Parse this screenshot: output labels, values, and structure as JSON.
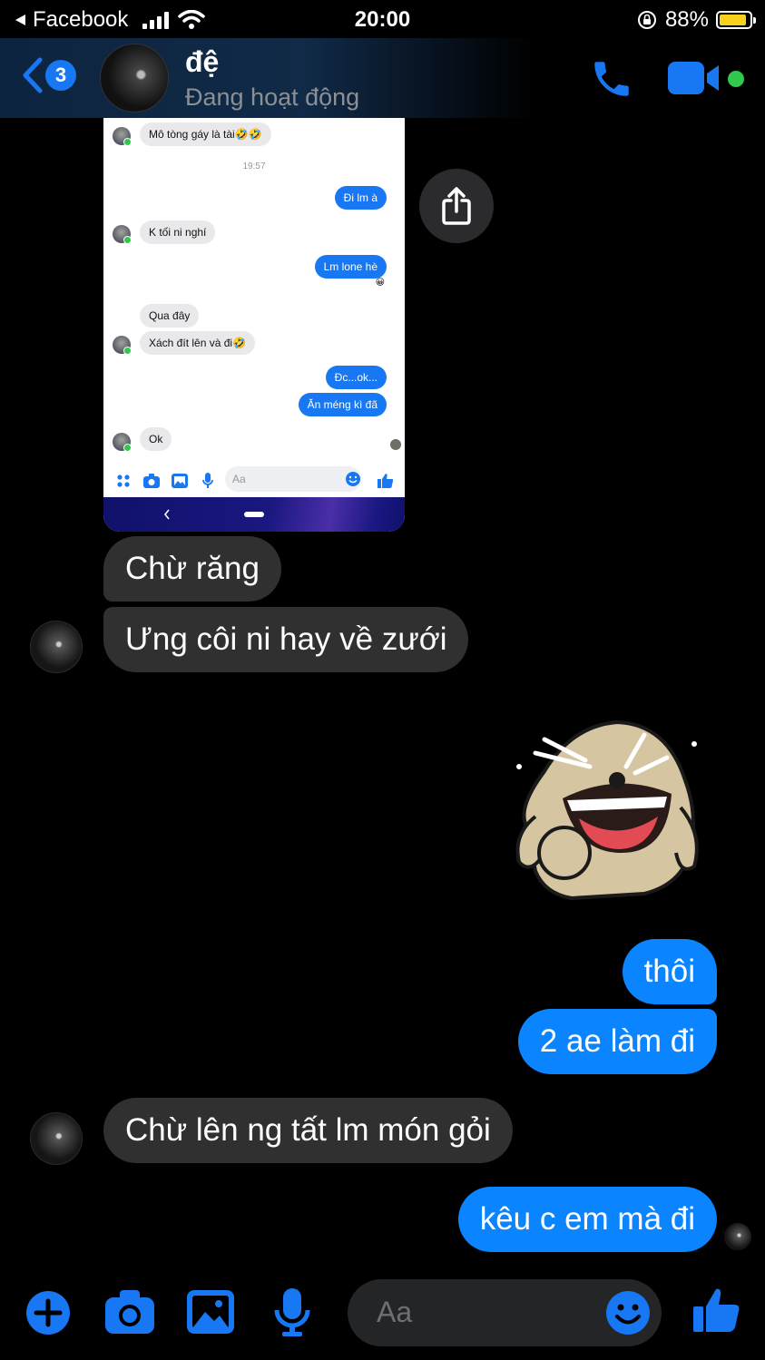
{
  "status_bar": {
    "back_app": "Facebook",
    "time": "20:00",
    "battery": "88%",
    "battery_level": 0.88
  },
  "header": {
    "unread_count": "3",
    "contact_name": "đệ",
    "contact_status": "Đang hoạt động",
    "icons": [
      "back-chevron-icon",
      "phone-icon",
      "video-camera-icon"
    ],
    "accent": "#1877f2",
    "online_color": "#31c84b"
  },
  "shared_screenshot": {
    "messages": [
      {
        "side": "in",
        "text": "Mô tòng gáy là tài🤣🤣"
      },
      {
        "side": "in",
        "text": "K tối ni nghí"
      },
      {
        "side": "out",
        "text": "Đi lm à"
      },
      {
        "side": "out",
        "text": "Lm lone hè"
      },
      {
        "side": "in",
        "text": "Qua đây"
      },
      {
        "side": "in",
        "text": "Xách đít lên và đi🤣"
      },
      {
        "side": "out",
        "text": "Đc...ok..."
      },
      {
        "side": "out",
        "text": "Ăn méng kì đã"
      },
      {
        "side": "in",
        "text": "Ok"
      }
    ],
    "timestamp": "19:57",
    "reaction": "😀",
    "input_placeholder": "Aa"
  },
  "chat": {
    "incoming_1": "Chừ răng",
    "incoming_2": "Ưng côi ni hay về zưới",
    "outgoing_1": "thôi",
    "outgoing_2": "2 ae làm đi",
    "incoming_3": "Chừ lên ng tất lm món gỏi",
    "outgoing_3": "kêu c em mà đi",
    "bubble_out_color": "#0a84ff",
    "bubble_in_color": "#303030"
  },
  "composer": {
    "placeholder": "Aa",
    "icons": [
      "plus-icon",
      "camera-icon",
      "image-icon",
      "microphone-icon",
      "emoji-icon",
      "thumbs-up-icon"
    ]
  }
}
